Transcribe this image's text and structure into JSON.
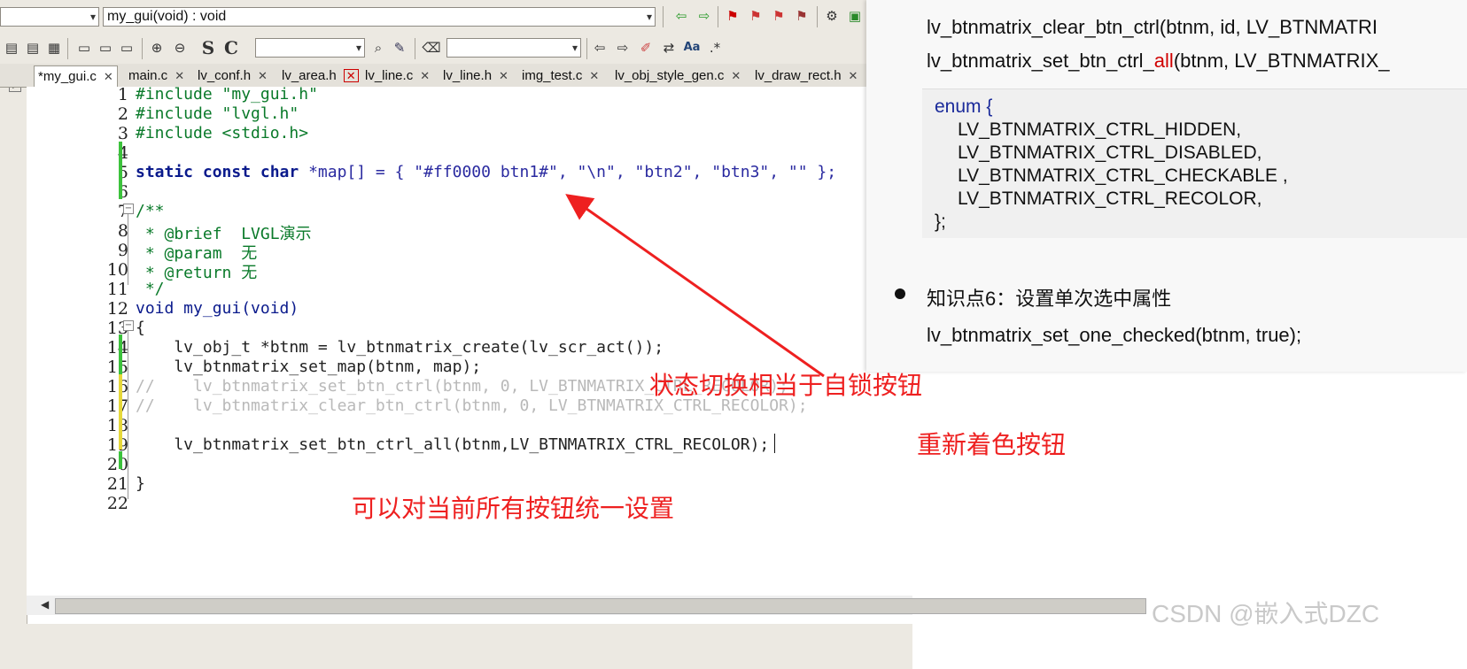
{
  "toolbar": {
    "function_combo": "my_gui(void) : void",
    "icons": [
      "flag-icon",
      "bookmark-icon",
      "search-icon",
      "settings-icon"
    ],
    "bold_s": "S",
    "bold_c": "C",
    "aa_label": "Aa"
  },
  "tabs": [
    {
      "label": "*my_gui.c",
      "active": true
    },
    {
      "label": "main.c"
    },
    {
      "label": "lv_conf.h"
    },
    {
      "label": "lv_area.h"
    },
    {
      "label": "lv_line.c"
    },
    {
      "label": "lv_line.h"
    },
    {
      "label": "img_test.c"
    },
    {
      "label": "lv_obj_style_gen.c"
    },
    {
      "label": "lv_draw_rect.h"
    }
  ],
  "code": {
    "line_numbers": [
      "1",
      "2",
      "3",
      "4",
      "5",
      "6",
      "7",
      "8",
      "9",
      "10",
      "11",
      "12",
      "13",
      "14",
      "15",
      "16",
      "17",
      "18",
      "19",
      "20",
      "21",
      "22"
    ],
    "l1": "#include \"my_gui.h\"",
    "l2": "#include \"lvgl.h\"",
    "l3": "#include <stdio.h>",
    "l5a": "static const char ",
    "l5b": "*map[] = { \"#ff0000 btn1#\", \"\\n\", \"btn2\", \"btn3\", \"\" };",
    "l7": "/**",
    "l8": " * @brief  LVGL演示",
    "l9": " * @param  无",
    "l10": " * @return 无",
    "l11": " */",
    "l12": "void my_gui(void)",
    "l13": "{",
    "l14": "    lv_obj_t *btnm = lv_btnmatrix_create(lv_scr_act());",
    "l15": "    lv_btnmatrix_set_map(btnm, map);",
    "l16": "//    lv_btnmatrix_set_btn_ctrl(btnm, 0, LV_BTNMATRIX_CTRL_RECOLOR);",
    "l17": "//    lv_btnmatrix_clear_btn_ctrl(btnm, 0, LV_BTNMATRIX_CTRL_RECOLOR);",
    "l19": "    lv_btnmatrix_set_btn_ctrl_all(btnm,LV_BTNMATRIX_CTRL_RECOLOR);",
    "l21": "}"
  },
  "slide": {
    "line_clear": "lv_btnmatrix_clear_btn_ctrl(btnm, id, LV_BTNMATRI",
    "line_set_all_a": "lv_btnmatrix_set_btn_ctrl_",
    "line_set_all_b": "all",
    "line_set_all_c": "(btnm, LV_BTNMATRIX_",
    "enum_open": "enum {",
    "enum_items": [
      "LV_BTNMATRIX_CTRL_HIDDEN,",
      "LV_BTNMATRIX_CTRL_DISABLED,",
      "LV_BTNMATRIX_CTRL_CHECKABLE ,",
      "LV_BTNMATRIX_CTRL_RECOLOR,"
    ],
    "enum_close": "};",
    "bullet_title": "知识点6：设置单次选中属性",
    "bullet_code": "lv_btnmatrix_set_one_checked(btnm, true);"
  },
  "annotations": {
    "toggle_note": "状态切换相当于自锁按钮",
    "recolor_note": "重新着色按钮",
    "all_note": "可以对当前所有按钮统一设置"
  },
  "watermark": "CSDN @嵌入式DZC",
  "colors": {
    "annotation": "#ee2020",
    "arrow": "#ee2020",
    "slide_accent": "#d00000"
  }
}
